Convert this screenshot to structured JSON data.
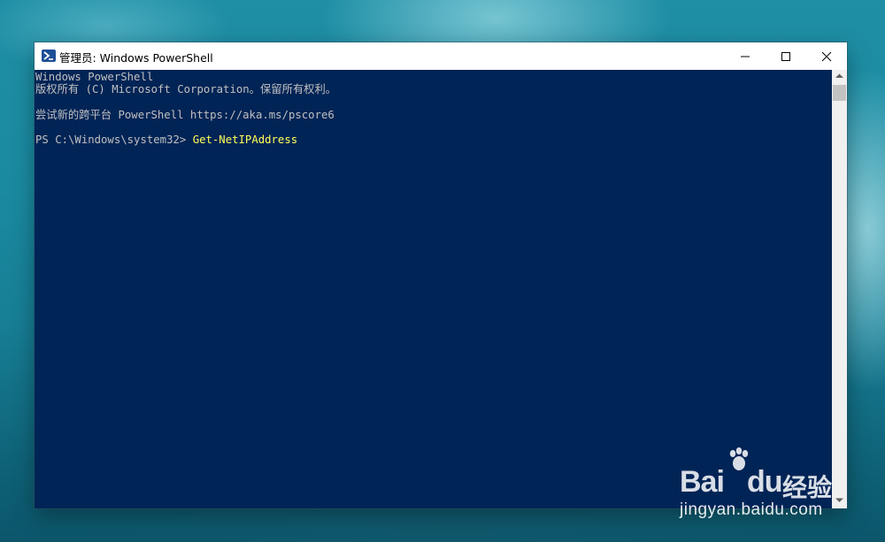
{
  "window": {
    "title": "管理员: Windows PowerShell",
    "icon": "powershell-icon",
    "buttons": {
      "minimize": "minimize-icon",
      "maximize": "maximize-icon",
      "close": "close-icon"
    }
  },
  "console": {
    "lines": [
      "Windows PowerShell",
      "版权所有 (C) Microsoft Corporation。保留所有权利。",
      "",
      "尝试新的跨平台 PowerShell https://aka.ms/pscore6",
      ""
    ],
    "prompt": "PS C:\\Windows\\system32> ",
    "command": "Get-NetIPAddress"
  },
  "colors": {
    "console_bg": "#012456",
    "console_text": "#c0c0c0",
    "command_text": "#ffff57"
  },
  "watermark": {
    "brand_left": "Bai",
    "brand_right": "du",
    "brand_suffix": "经验",
    "url": "jingyan.baidu.com"
  }
}
